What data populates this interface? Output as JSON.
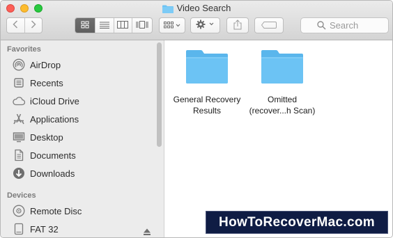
{
  "window": {
    "title": "Video Search"
  },
  "toolbar": {
    "search_placeholder": "Search",
    "view_modes": [
      "icon-view",
      "list-view",
      "column-view",
      "cover-flow-view"
    ],
    "active_view": "icon-view"
  },
  "sidebar": {
    "favorites_heading": "Favorites",
    "favorites": [
      {
        "label": "AirDrop",
        "icon": "airdrop-icon"
      },
      {
        "label": "Recents",
        "icon": "recents-icon"
      },
      {
        "label": "iCloud Drive",
        "icon": "icloud-icon"
      },
      {
        "label": "Applications",
        "icon": "applications-icon"
      },
      {
        "label": "Desktop",
        "icon": "desktop-icon"
      },
      {
        "label": "Documents",
        "icon": "documents-icon"
      },
      {
        "label": "Downloads",
        "icon": "downloads-icon"
      }
    ],
    "devices_heading": "Devices",
    "devices": [
      {
        "label": "Remote Disc",
        "icon": "remote-disc-icon"
      },
      {
        "label": "FAT 32",
        "icon": "drive-icon"
      }
    ]
  },
  "content": {
    "items": [
      {
        "line1": "General Recovery",
        "line2": "Results"
      },
      {
        "line1": "Omitted",
        "line2": "(recover...h Scan)"
      }
    ]
  },
  "watermark": {
    "text": "HowToRecoverMac.com"
  },
  "colors": {
    "folder": "#6cc3f4",
    "folder_tab": "#5ab6ec",
    "accent": "#0f1c44"
  }
}
